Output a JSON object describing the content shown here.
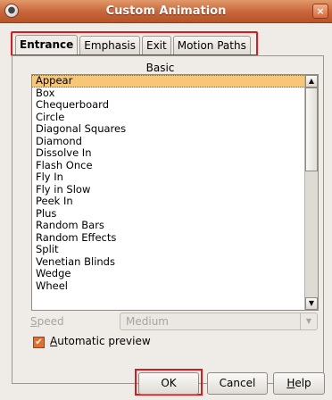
{
  "window": {
    "title": "Custom Animation",
    "close_symbol": "×",
    "menu_symbol": "●"
  },
  "tabs": [
    {
      "label": "Entrance",
      "active": true
    },
    {
      "label": "Emphasis",
      "active": false
    },
    {
      "label": "Exit",
      "active": false
    },
    {
      "label": "Motion Paths",
      "active": false
    }
  ],
  "effects": {
    "category": "Basic",
    "items": [
      "Appear",
      "Box",
      "Chequerboard",
      "Circle",
      "Diagonal Squares",
      "Diamond",
      "Dissolve In",
      "Flash Once",
      "Fly In",
      "Fly in Slow",
      "Peek In",
      "Plus",
      "Random Bars",
      "Random Effects",
      "Split",
      "Venetian Blinds",
      "Wedge",
      "Wheel"
    ],
    "selected": "Appear"
  },
  "speed": {
    "label": "Speed",
    "value": "Medium"
  },
  "preview": {
    "label": "Automatic preview",
    "checked": true
  },
  "buttons": {
    "ok": "OK",
    "cancel": "Cancel",
    "help": "Help"
  },
  "icons": {
    "menu": "window-menu-icon",
    "close": "close-icon",
    "check": "checkmark-icon",
    "scroll_up": "scroll-up-icon",
    "scroll_down": "scroll-down-icon",
    "dropdown": "chevron-down-icon"
  }
}
